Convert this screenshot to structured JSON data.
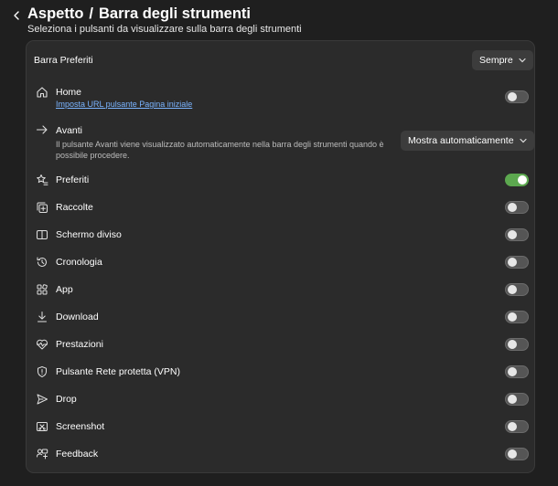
{
  "header": {
    "title_part1": "Aspetto",
    "title_sep": "/",
    "title_part2": "Barra degli strumenti",
    "subtitle": "Seleziona i pulsanti da visualizzare sulla barra degli strumenti"
  },
  "favorites_bar": {
    "label": "Barra Preferiti",
    "dropdown_value": "Sempre"
  },
  "home": {
    "label": "Home",
    "link": "Imposta URL pulsante Pagina iniziale",
    "enabled": false
  },
  "forward": {
    "label": "Avanti",
    "description": "Il pulsante Avanti viene visualizzato automaticamente nella barra degli strumenti quando è possibile procedere.",
    "dropdown_value": "Mostra automaticamente"
  },
  "items": [
    {
      "label": "Preferiti",
      "icon": "star-list-icon",
      "enabled": true
    },
    {
      "label": "Raccolte",
      "icon": "collections-icon",
      "enabled": false
    },
    {
      "label": "Schermo diviso",
      "icon": "split-screen-icon",
      "enabled": false
    },
    {
      "label": "Cronologia",
      "icon": "history-icon",
      "enabled": false
    },
    {
      "label": "App",
      "icon": "apps-icon",
      "enabled": false
    },
    {
      "label": "Download",
      "icon": "download-icon",
      "enabled": false
    },
    {
      "label": "Prestazioni",
      "icon": "performance-icon",
      "enabled": false
    },
    {
      "label": "Pulsante Rete protetta (VPN)",
      "icon": "shield-icon",
      "enabled": false
    },
    {
      "label": "Drop",
      "icon": "send-icon",
      "enabled": false
    },
    {
      "label": "Screenshot",
      "icon": "screenshot-icon",
      "enabled": false
    },
    {
      "label": "Feedback",
      "icon": "feedback-icon",
      "enabled": false
    }
  ],
  "colors": {
    "background": "#1f1f1f",
    "card": "#2b2b2b",
    "toggle_on": "#5ca84f",
    "toggle_off": "#555555",
    "link": "#7ab4ff"
  }
}
